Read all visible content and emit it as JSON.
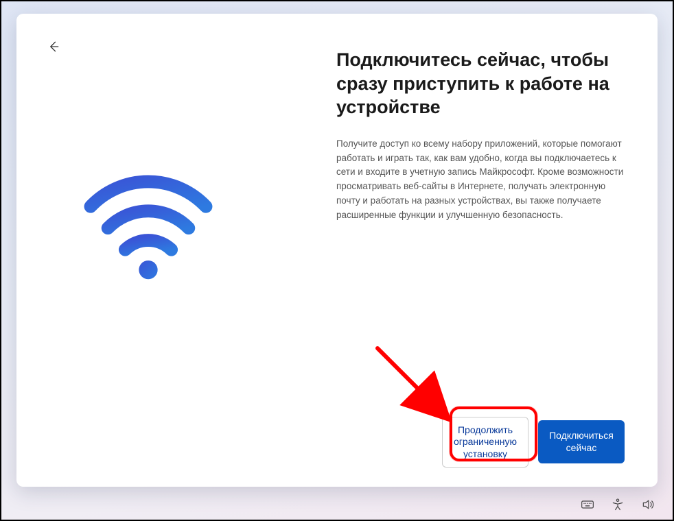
{
  "icons": {
    "back": "arrow-left",
    "wifi": "wifi"
  },
  "heading": "Подключитесь сейчас, чтобы сразу приступить к работе на устройстве",
  "description": "Получите доступ ко всему набору приложений, которые помогают работать и играть так, как вам удобно, когда вы подключаетесь к сети и входите в учетную запись Майкрософт. Кроме возможности просматривать веб-сайты в Интернете, получать электронную почту и работать на разных устройствах, вы также получаете расширенные функции и улучшенную безопасность.",
  "buttons": {
    "secondary": "Продолжить ограниченную установку",
    "primary": "Подключиться сейчас"
  },
  "annotation": {
    "target": "secondary-button"
  }
}
